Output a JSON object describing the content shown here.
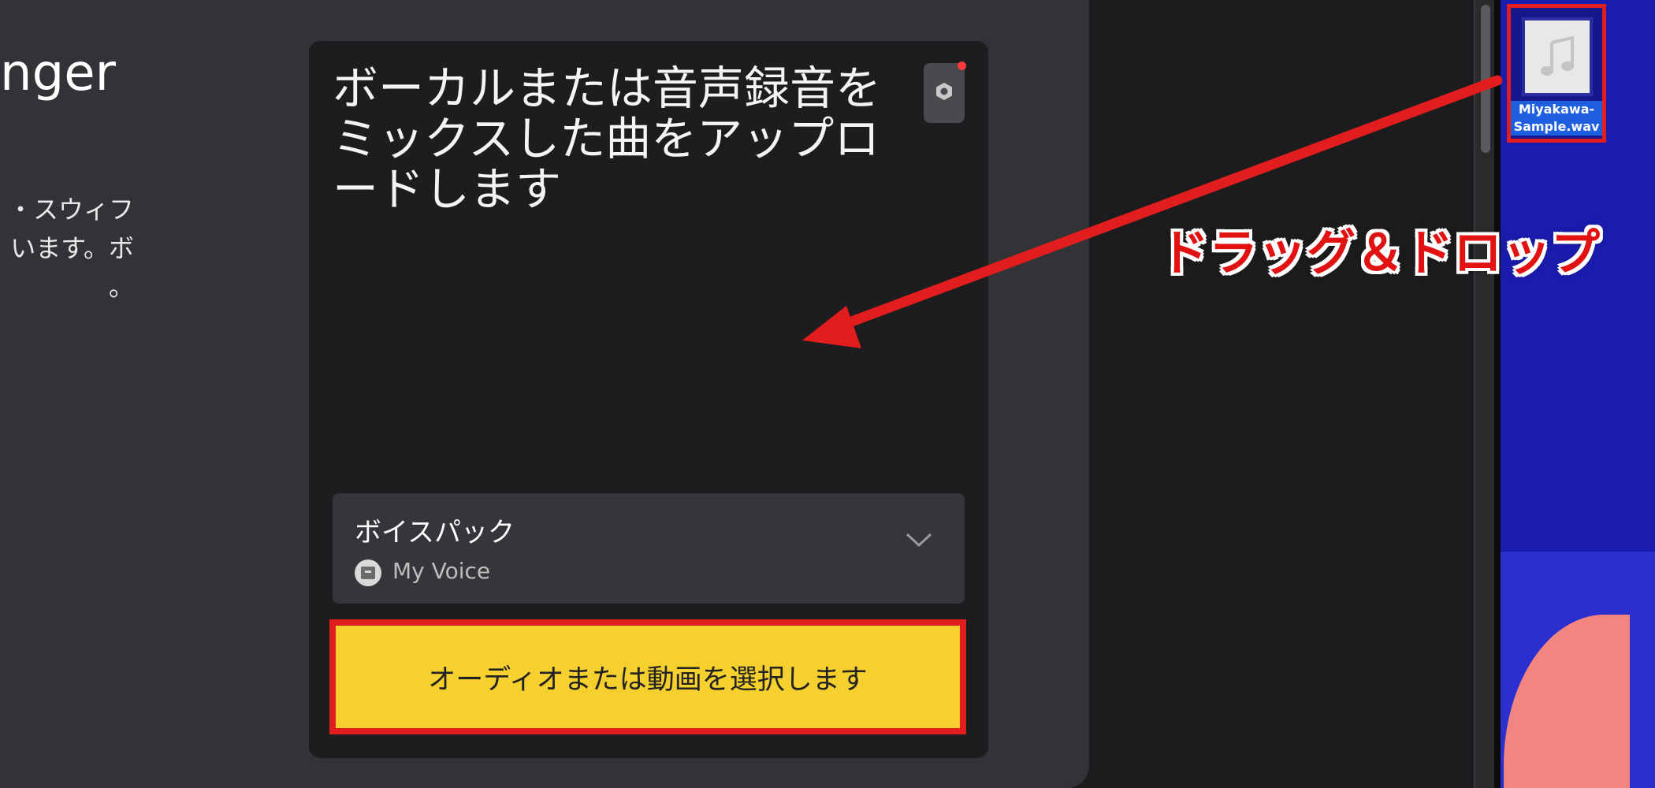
{
  "left_panel": {
    "title": "nger",
    "description": "・スウィフ\nいます。ボ\n。"
  },
  "upload": {
    "prompt": "ボーカルまたは音声録音を\nミックスした曲をアップロ\nードします"
  },
  "voice_pack": {
    "label": "ボイスパック",
    "value": "My Voice"
  },
  "select_button": {
    "label": "オーディオまたは動画を選択します"
  },
  "desktop_file": {
    "name": "Miyakawa-\nSample.wav"
  },
  "annotation": {
    "text": "ドラッグ＆ドロップ"
  },
  "colors": {
    "accent_yellow": "#f6d02e",
    "highlight_red": "#e21d1d",
    "notification": "#ff3b3b"
  },
  "icons": {
    "settings": "settings-icon",
    "chevron": "chevron-down-icon",
    "avatar": "avatar",
    "music_file": "music-file-icon"
  }
}
